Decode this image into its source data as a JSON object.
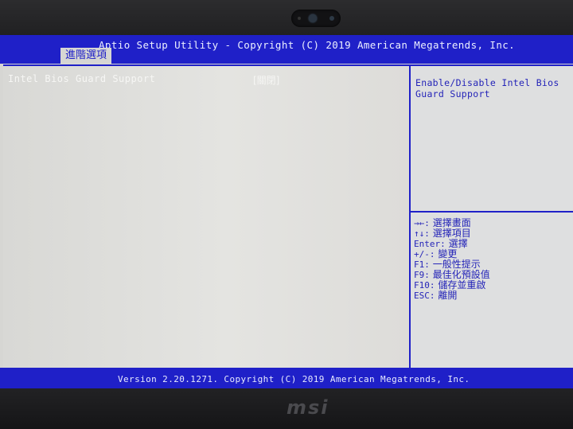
{
  "header": {
    "title": "Aptio Setup Utility - Copyright (C) 2019 American Megatrends, Inc.",
    "active_tab": "進階選項"
  },
  "settings": [
    {
      "label": "Intel Bios Guard Support",
      "value": "[關閉]"
    }
  ],
  "help": {
    "description": "Enable/Disable Intel Bios Guard Support",
    "keys": [
      {
        "key": "→←:",
        "action": "選擇畫面"
      },
      {
        "key": "↑↓:",
        "action": "選擇項目"
      },
      {
        "key": "Enter:",
        "action": "選擇"
      },
      {
        "key": "+/-:",
        "action": "變更"
      },
      {
        "key": "F1:",
        "action": "一般性提示"
      },
      {
        "key": "F9:",
        "action": "最佳化預設值"
      },
      {
        "key": "F10:",
        "action": "儲存並重啟"
      },
      {
        "key": "ESC:",
        "action": "離開"
      }
    ]
  },
  "footer": {
    "version": "Version 2.20.1271. Copyright (C) 2019 American Megatrends, Inc."
  },
  "device": {
    "logo": "msi"
  },
  "colors": {
    "header_blue": "#1f20c8",
    "background": "#d6d6d3",
    "help_text": "#2424b8"
  }
}
